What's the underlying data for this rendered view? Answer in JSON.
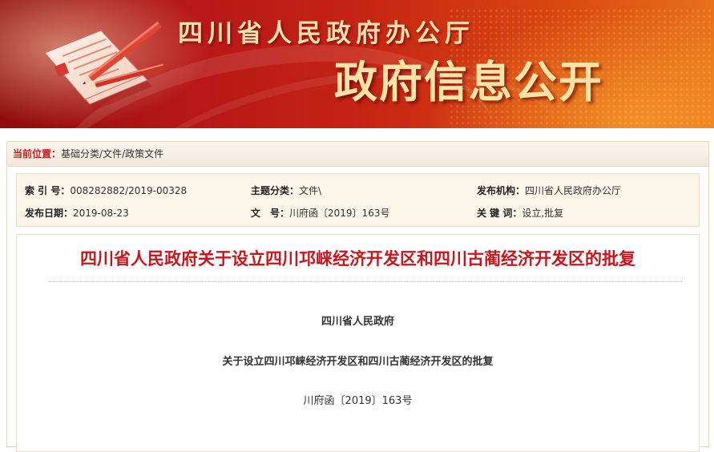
{
  "banner": {
    "org_title": "四川省人民政府办公厅",
    "section_title": "政府信息公开"
  },
  "breadcrumb": {
    "label": "当前位置：",
    "items": [
      "基础分类",
      "文件",
      "政策文件"
    ],
    "separators": [
      "/",
      "/"
    ]
  },
  "meta": {
    "index_label": "索 引 号：",
    "index_value": "008282882/2019-00328",
    "topic_label": "主题分类：",
    "topic_value": "文件\\",
    "issuer_label": "发布机构：",
    "issuer_value": "四川省人民政府办公厅",
    "date_label": "发布日期：",
    "date_value": "2019-08-23",
    "doc_label": "文　号：",
    "doc_value": "川府函〔2019〕163号",
    "keywords_label": "关 键 词：",
    "keywords_value": "设立,批复"
  },
  "article": {
    "title": "四川省人民政府关于设立四川邛崃经济开发区和四川古蔺经济开发区的批复",
    "issuer_line": "四川省人民政府",
    "subtitle_line": "关于设立四川邛崃经济开发区和四川古蔺经济开发区的批复",
    "doc_number_line": "川府函〔2019〕163号"
  },
  "colors": {
    "banner_dark_red": "#8e0c0c",
    "banner_orange": "#e8711a",
    "title_red": "#c8161d",
    "breadcrumb_label_red": "#c81e1e",
    "meta_background": "#fbf6ea"
  },
  "icons": {
    "banner_logo": "clipboard-document-pen-icon"
  }
}
